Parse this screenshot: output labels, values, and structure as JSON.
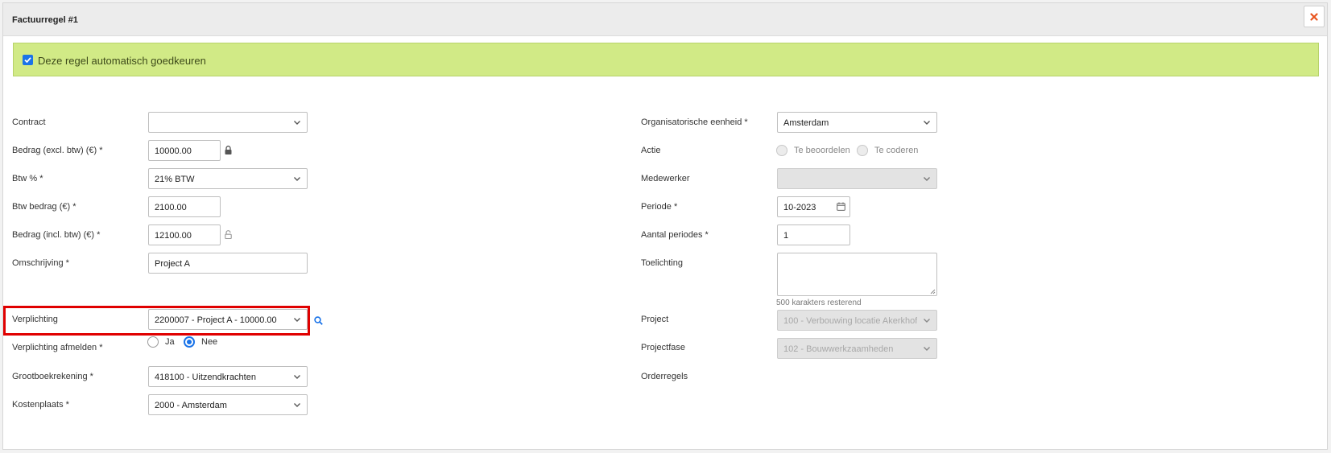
{
  "modal": {
    "title": "Factuurregel #1",
    "close_icon": "close-icon"
  },
  "alert": {
    "checkbox_checked": true,
    "text": "Deze regel automatisch goedkeuren"
  },
  "left": {
    "contract": {
      "label": "Contract",
      "value": ""
    },
    "bedrag_excl": {
      "label": "Bedrag (excl. btw) (€) *",
      "value": "10000.00",
      "icon": "lock-closed-icon"
    },
    "btw_pct": {
      "label": "Btw % *",
      "value": "21% BTW"
    },
    "btw_bedrag": {
      "label": "Btw bedrag (€) *",
      "value": "2100.00"
    },
    "bedrag_incl": {
      "label": "Bedrag (incl. btw) (€) *",
      "value": "12100.00",
      "icon": "lock-open-icon"
    },
    "omschrijving": {
      "label": "Omschrijving *",
      "value": "Project A"
    },
    "verplichting": {
      "label": "Verplichting",
      "value": "2200007 - Project A - 10000.00",
      "icon": "search-icon"
    },
    "verplichting_afmelden": {
      "label": "Verplichting afmelden *",
      "options": [
        {
          "label": "Ja",
          "checked": false
        },
        {
          "label": "Nee",
          "checked": true
        }
      ]
    },
    "grootboek": {
      "label": "Grootboekrekening *",
      "value": "418100 - Uitzendkrachten"
    },
    "kostenplaats": {
      "label": "Kostenplaats *",
      "value": "2000 - Amsterdam"
    }
  },
  "right": {
    "org_eenheid": {
      "label": "Organisatorische eenheid *",
      "value": "Amsterdam"
    },
    "actie": {
      "label": "Actie",
      "options": [
        {
          "label": "Te beoordelen",
          "checked": false
        },
        {
          "label": "Te coderen",
          "checked": false
        }
      ]
    },
    "medewerker": {
      "label": "Medewerker",
      "value": ""
    },
    "periode": {
      "label": "Periode *",
      "value": "10-2023",
      "icon": "calendar-icon"
    },
    "aantal_periodes": {
      "label": "Aantal periodes *",
      "value": "1"
    },
    "toelichting": {
      "label": "Toelichting",
      "value": "",
      "helper": "500 karakters resterend"
    },
    "project": {
      "label": "Project",
      "value": "100 - Verbouwing locatie Akerkhof"
    },
    "projectfase": {
      "label": "Projectfase",
      "value": "102 - Bouwwerkzaamheden"
    },
    "orderregels": {
      "label": "Orderregels"
    }
  },
  "colors": {
    "alert_bg": "#d1ea86",
    "accent": "#1a73e8",
    "close": "#e8541e",
    "highlight": "#e00000"
  }
}
